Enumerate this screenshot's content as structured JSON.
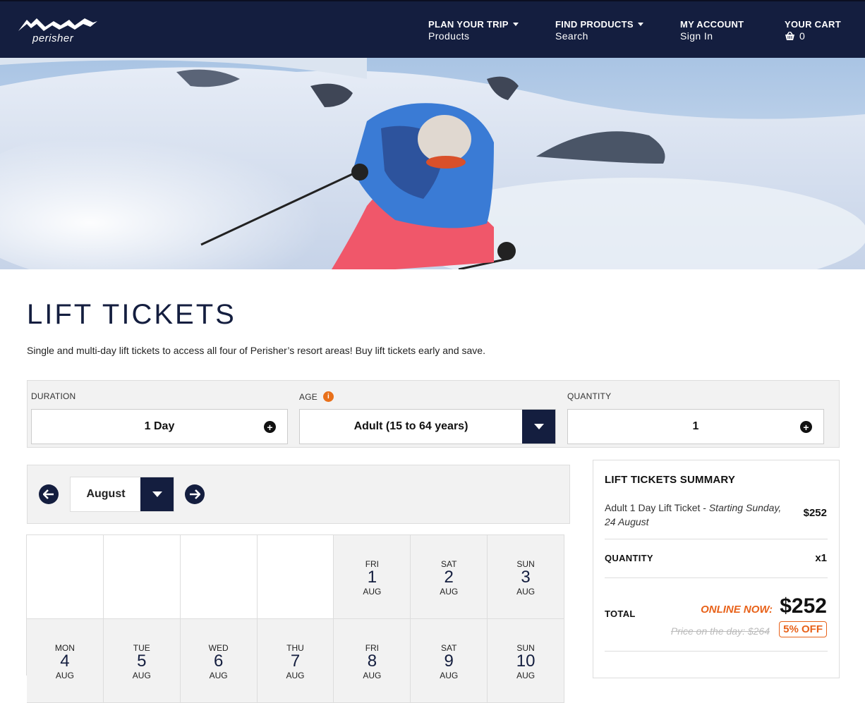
{
  "header": {
    "logo_text": "perisher",
    "nav": [
      {
        "title": "PLAN YOUR TRIP",
        "sub": "Products",
        "dropdown": true
      },
      {
        "title": "FIND PRODUCTS",
        "sub": "Search",
        "dropdown": true
      },
      {
        "title": "MY ACCOUNT",
        "sub": "Sign In",
        "dropdown": false
      },
      {
        "title": "YOUR CART",
        "sub": "0",
        "dropdown": false
      }
    ]
  },
  "page": {
    "title": "LIFT TICKETS",
    "intro": "Single and multi-day lift tickets to access all four of Perisher’s resort areas! Buy lift tickets early and save."
  },
  "options": {
    "duration": {
      "label": "DURATION",
      "value": "1 Day"
    },
    "age": {
      "label": "AGE",
      "value": "Adult (15 to 64 years)",
      "info_icon": "i"
    },
    "quantity": {
      "label": "QUANTITY",
      "value": "1"
    }
  },
  "calendar": {
    "month": "August",
    "rows": [
      [
        {
          "empty": true
        },
        {
          "empty": true
        },
        {
          "empty": true
        },
        {
          "empty": true
        },
        {
          "dow": "FRI",
          "day": "1",
          "mon": "AUG"
        },
        {
          "dow": "SAT",
          "day": "2",
          "mon": "AUG"
        },
        {
          "dow": "SUN",
          "day": "3",
          "mon": "AUG"
        }
      ],
      [
        {
          "dow": "MON",
          "day": "4",
          "mon": "AUG"
        },
        {
          "dow": "TUE",
          "day": "5",
          "mon": "AUG"
        },
        {
          "dow": "WED",
          "day": "6",
          "mon": "AUG"
        },
        {
          "dow": "THU",
          "day": "7",
          "mon": "AUG"
        },
        {
          "dow": "FRI",
          "day": "8",
          "mon": "AUG"
        },
        {
          "dow": "SAT",
          "day": "9",
          "mon": "AUG"
        },
        {
          "dow": "SUN",
          "day": "10",
          "mon": "AUG"
        }
      ]
    ]
  },
  "summary": {
    "title": "LIFT TICKETS SUMMARY",
    "item_name": "Adult 1 Day Lift Ticket - ",
    "item_date": "Starting Sunday, 24 August",
    "item_price": "$252",
    "quantity_label": "QUANTITY",
    "quantity_value": "x1",
    "total_label": "TOTAL",
    "online_now": "ONLINE NOW:",
    "total_price": "$252",
    "day_price": "Price on the day: $264",
    "discount": "5% OFF"
  },
  "colors": {
    "navy": "#141e3f",
    "accent_orange": "#e8621a",
    "panel_gray": "#f2f2f2"
  }
}
